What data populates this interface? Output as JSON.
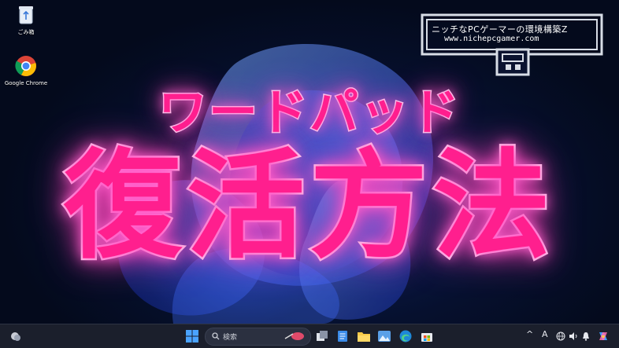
{
  "desktop": {
    "icons": [
      {
        "label": "ごみ箱",
        "icon": "recycle-bin-icon"
      },
      {
        "label": "Google Chrome",
        "icon": "chrome-icon"
      }
    ]
  },
  "overlay": {
    "title_line1": "ワードパッド",
    "title_line2": "復活方法",
    "text_color": "#ff1f8e",
    "glow_color": "#ff3fb8"
  },
  "logo": {
    "name": "ニッチなPCゲーマーの環境構築Z",
    "url": "www.nichepcgamer.com"
  },
  "taskbar": {
    "search_placeholder": "検索",
    "ime_indicator": "A",
    "pinned": [
      "start-icon",
      "task-view-icon",
      "notepad-icon",
      "file-explorer-icon",
      "photos-icon",
      "edge-icon",
      "store-icon"
    ],
    "tray": [
      "chevron-up-icon",
      "ime-indicator",
      "globe-icon",
      "volume-icon",
      "notification-bell-icon",
      "copilot-icon"
    ],
    "accent": "#1f6fe0"
  }
}
